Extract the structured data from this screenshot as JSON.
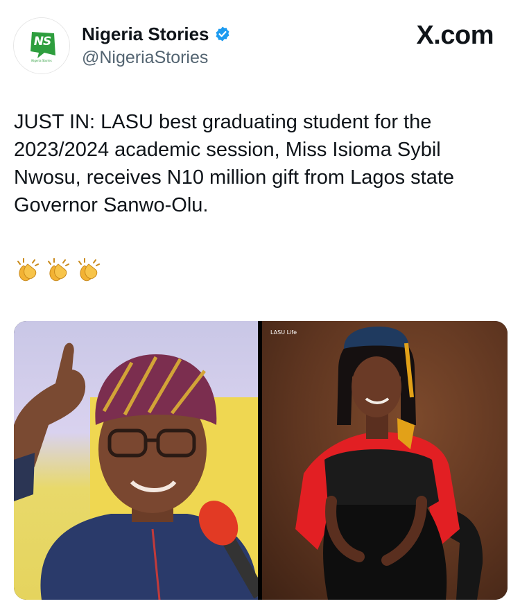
{
  "tweet": {
    "author": {
      "display_name": "Nigeria Stories",
      "handle": "@NigeriaStories",
      "verified": true,
      "avatar_icon": "nigeria-stories-logo",
      "avatar_caption": "Nigeria Stories"
    },
    "brand": "X.com",
    "text": "JUST IN: LASU best graduating student for the 2023/2024 academic session, Miss Isioma Sybil Nwosu, receives N10 million gift from Lagos state Governor Sanwo-Olu.",
    "emojis": [
      "👏",
      "👏",
      "👏"
    ],
    "media": {
      "left_photo_icon": "governor-photo",
      "right_photo_icon": "graduate-photo",
      "right_watermark": "LASU Life"
    }
  },
  "colors": {
    "verified_badge": "#1d9bf0",
    "handle_gray": "#536471",
    "nigeria_green": "#2e9e3e"
  }
}
